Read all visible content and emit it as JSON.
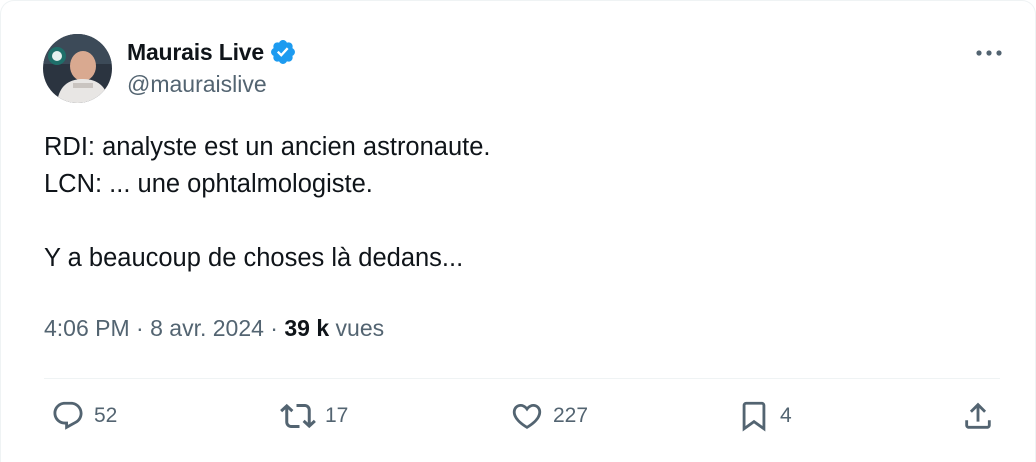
{
  "author": {
    "display_name": "Maurais Live",
    "handle": "@mauraislive",
    "verified": true,
    "verified_color": "#1d9bf0",
    "avatar": "profile-photo"
  },
  "tweet": {
    "lines": [
      "RDI: analyste est un ancien astronaute.",
      "LCN: ... une ophtalmologiste.",
      "",
      "Y a beaucoup de choses là dedans..."
    ]
  },
  "meta": {
    "time": "4:06 PM",
    "separator": " · ",
    "date": "8 avr. 2024",
    "views_count": "39 k",
    "views_label": " vues"
  },
  "actions": {
    "reply": {
      "icon": "reply-icon",
      "count": "52"
    },
    "retweet": {
      "icon": "retweet-icon",
      "count": "17"
    },
    "like": {
      "icon": "heart-icon",
      "count": "227"
    },
    "bookmark": {
      "icon": "bookmark-icon",
      "count": "4"
    },
    "share": {
      "icon": "share-icon"
    }
  },
  "colors": {
    "text": "#0f1419",
    "secondary": "#536471",
    "border": "#eff3f4"
  }
}
